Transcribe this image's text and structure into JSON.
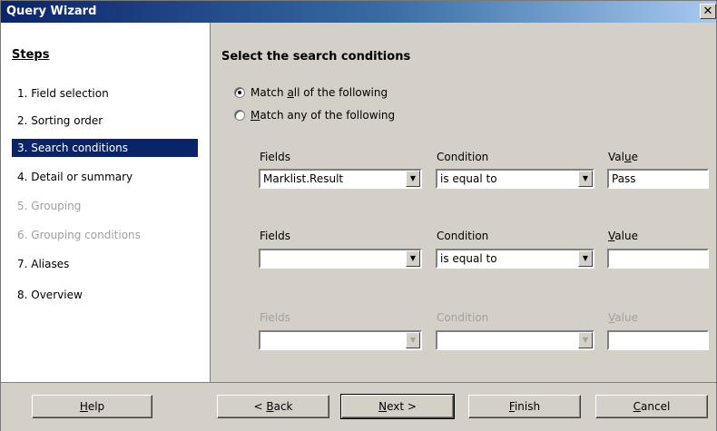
{
  "window": {
    "title": "Query Wizard",
    "close_glyph": "✕"
  },
  "steps": {
    "heading": "Steps",
    "items": [
      {
        "label": "1.  Field selection",
        "state": "normal"
      },
      {
        "label": "2.  Sorting order",
        "state": "normal"
      },
      {
        "label": "3.  Search conditions",
        "state": "active"
      },
      {
        "label": "4.  Detail or summary",
        "state": "normal"
      },
      {
        "label": "5.  Grouping",
        "state": "disabled"
      },
      {
        "label": "6.  Grouping conditions",
        "state": "disabled"
      },
      {
        "label": "7.  Aliases",
        "state": "normal"
      },
      {
        "label": "8.  Overview",
        "state": "normal"
      }
    ]
  },
  "content": {
    "heading": "Select the search conditions",
    "radio_all": {
      "pre": "Match ",
      "u": "a",
      "post": "ll of the following",
      "selected": true
    },
    "radio_any": {
      "pre": "",
      "u": "M",
      "post": "atch any of the following",
      "selected": false
    },
    "rows": [
      {
        "fields_label": "Fields",
        "condition_label": "Condition",
        "value_label_pre": "Val",
        "value_label_u": "u",
        "value_label_post": "e",
        "field_value": "Marklist.Result",
        "condition_value": "is equal to",
        "value": "Pass",
        "enabled": true
      },
      {
        "fields_label": "Fields",
        "condition_label": "Condition",
        "value_label_pre": "",
        "value_label_u": "V",
        "value_label_post": "alue",
        "field_value": "",
        "condition_value": "is equal to",
        "value": "",
        "enabled": true
      },
      {
        "fields_label": "Fields",
        "condition_label": "Condition",
        "value_label_pre": "",
        "value_label_u": "V",
        "value_label_post": "alue",
        "field_value": "",
        "condition_value": "",
        "value": "",
        "enabled": false
      }
    ]
  },
  "buttons": {
    "help": {
      "u": "H",
      "post": "elp"
    },
    "back": {
      "pre": "< ",
      "u": "B",
      "post": "ack"
    },
    "next": {
      "u": "N",
      "post": "ext >"
    },
    "finish": {
      "u": "F",
      "post": "inish"
    },
    "cancel": {
      "u": "C",
      "post": "ancel"
    }
  }
}
